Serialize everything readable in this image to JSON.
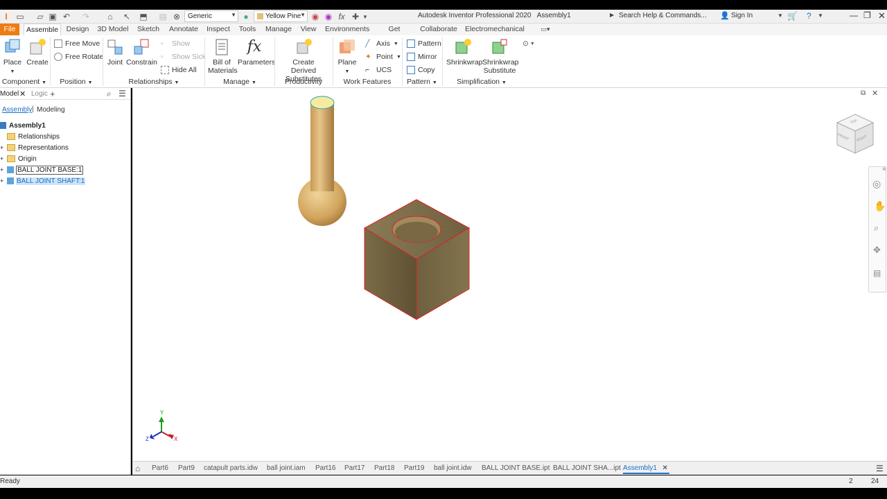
{
  "window": {
    "title": "Autodesk Inventor Professional 2020",
    "document": "Assembly1",
    "search_placeholder": "Search Help & Commands...",
    "sign_in": "Sign In",
    "appearance_dropdown": "Generic",
    "material_dropdown": "Yellow Pine"
  },
  "tabs": [
    "File",
    "Assemble",
    "Design",
    "3D Model",
    "Sketch",
    "Annotate",
    "Inspect",
    "Tools",
    "Manage",
    "View",
    "Environments",
    "Get Started",
    "Collaborate",
    "Electromechanical"
  ],
  "ribbon": {
    "place": "Place",
    "create": "Create",
    "free_move": "Free Move",
    "free_rotate": "Free Rotate",
    "joint": "Joint",
    "constrain": "Constrain",
    "show": "Show",
    "show_sick": "Show Sick",
    "hide_all": "Hide All",
    "bill_of": "Bill of",
    "materials": "Materials",
    "parameters": "Parameters",
    "create_derived": "Create Derived",
    "substitutes": "Substitutes",
    "plane": "Plane",
    "axis": "Axis",
    "point": "Point",
    "ucs": "UCS",
    "pattern": "Pattern",
    "mirror": "Mirror",
    "copy": "Copy",
    "shrinkwrap": "Shrinkwrap",
    "shrinkwrap_sub_1": "Shrinkwrap",
    "shrinkwrap_sub_2": "Substitute",
    "panels": {
      "component": "Component",
      "position": "Position",
      "relationships": "Relationships",
      "manage": "Manage",
      "productivity": "Productivity",
      "work_features": "Work Features",
      "pattern": "Pattern",
      "simplification": "Simplification"
    }
  },
  "browser": {
    "tab_model": "Model",
    "tab_logic": "Logic",
    "mode_assembly": "Assembly",
    "mode_modeling": "Modeling",
    "root": "Assembly1",
    "items": [
      "Relationships",
      "Representations",
      "Origin",
      "BALL JOINT BASE:1",
      "BALL JOINT SHAFT:1"
    ]
  },
  "viewcube": {
    "top": "TOP",
    "front": "FRONT",
    "right": "RIGHT"
  },
  "axis_labels": {
    "x": "X",
    "y": "Y",
    "z": "Z"
  },
  "doc_tabs": [
    "Part6",
    "Part9",
    "catapult parts.idw",
    "ball joint.iam",
    "Part16",
    "Part17",
    "Part18",
    "Part19",
    "ball joint.idw",
    "BALL JOINT BASE.ipt",
    "BALL JOINT SHA...ipt",
    "Assembly1"
  ],
  "status": {
    "text": "Ready",
    "count_a": "2",
    "count_b": "24"
  },
  "colors": {
    "accent": "#1a6fc4",
    "file_tab": "#ef7c10",
    "wood_light": "#e4c07c",
    "wood_dark": "#7a6a44"
  }
}
